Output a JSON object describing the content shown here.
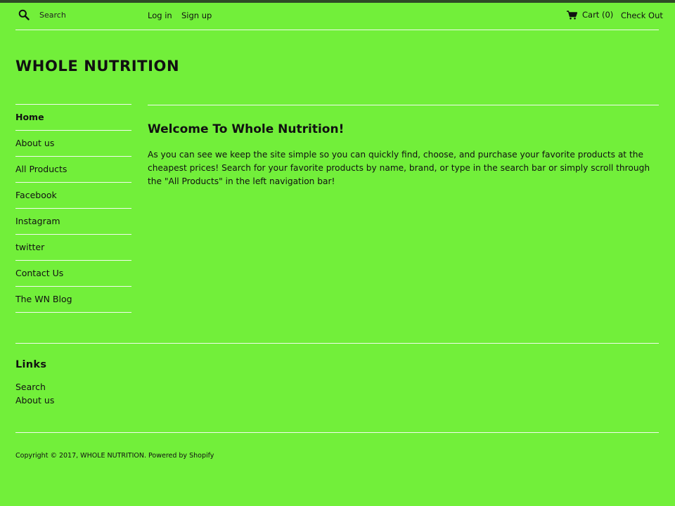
{
  "header": {
    "search_placeholder": "Search",
    "login": "Log in",
    "signup": "Sign up",
    "cart": "Cart (0)",
    "checkout": "Check Out",
    "accent_color": "#2e4a26"
  },
  "site": {
    "title": "WHOLE NUTRITION",
    "background": "#72ef3a"
  },
  "sidebar": {
    "items": [
      {
        "label": "Home"
      },
      {
        "label": "About us"
      },
      {
        "label": "All Products"
      },
      {
        "label": "Facebook"
      },
      {
        "label": "Instagram"
      },
      {
        "label": "twitter"
      },
      {
        "label": "Contact Us"
      },
      {
        "label": "The WN Blog"
      }
    ]
  },
  "main": {
    "heading": "Welcome To Whole Nutrition!",
    "body": "As you can see we keep the site simple so you can quickly find, choose, and purchase your favorite products at the cheapest prices! Search for your favorite products by name, brand, or type in the search bar or simply scroll through the \"All Products\" in the left navigation bar!"
  },
  "footer": {
    "links_heading": "Links",
    "links": [
      {
        "label": "Search"
      },
      {
        "label": "About us"
      }
    ],
    "copyright": "Copyright © 2017, WHOLE NUTRITION. Powered by Shopify"
  }
}
